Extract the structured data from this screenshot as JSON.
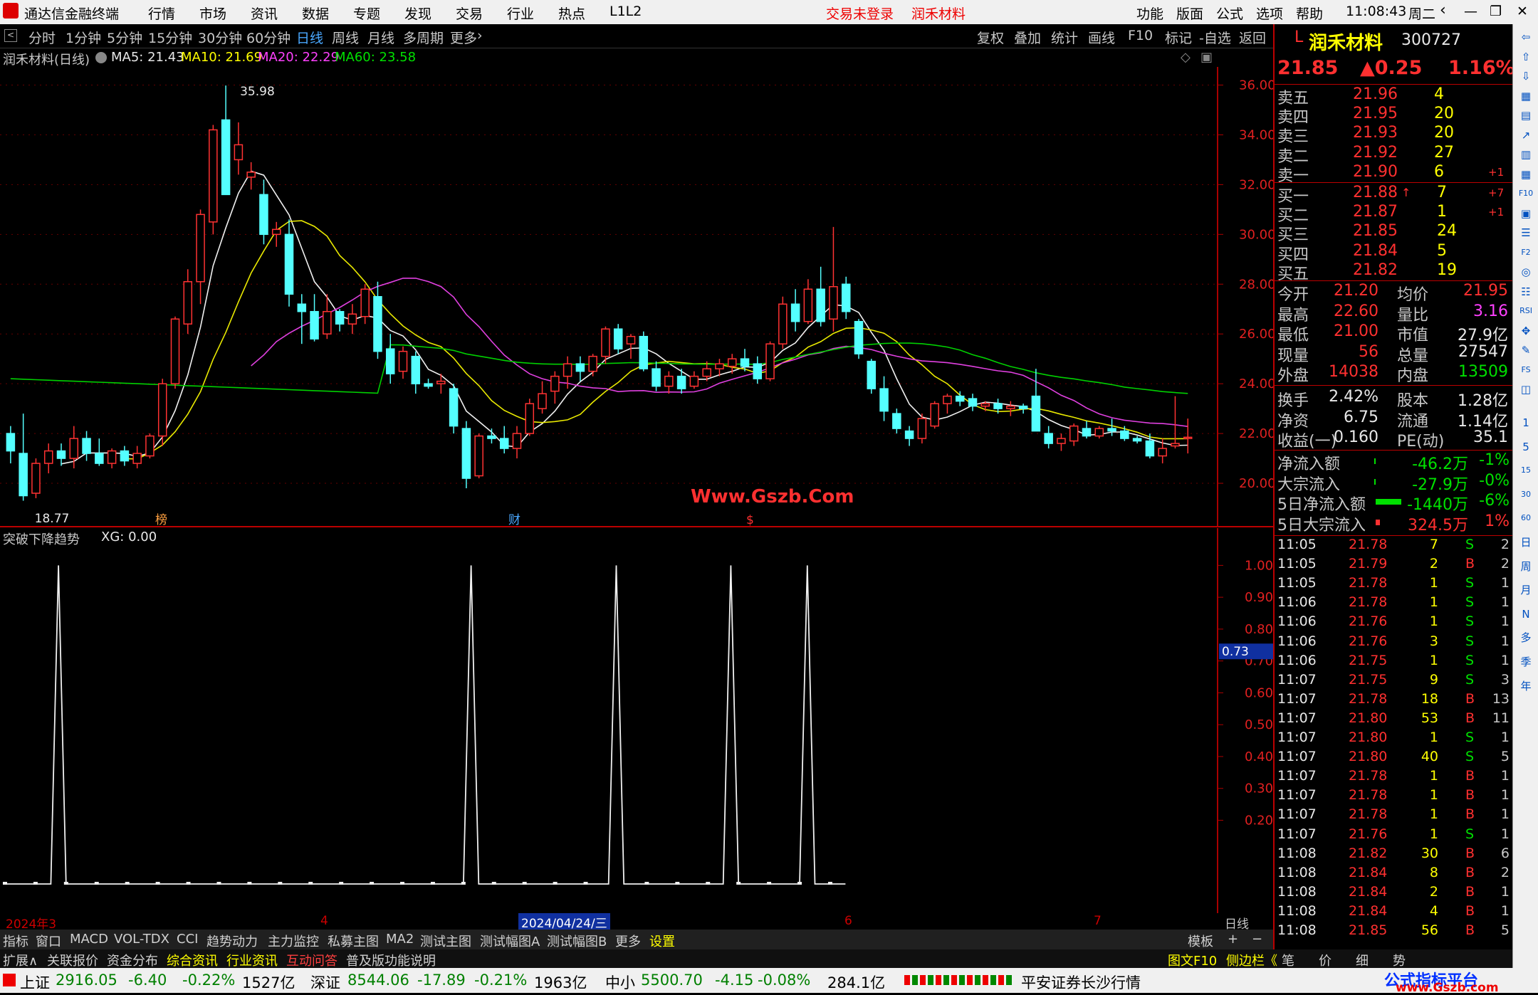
{
  "app": {
    "title": "通达信金融终端",
    "menu": [
      "行情",
      "市场",
      "资讯",
      "数据",
      "专题",
      "发现",
      "交易",
      "行业",
      "热点",
      "L1L2"
    ],
    "notice": "交易未登录",
    "stock_link": "润禾材料",
    "right_menu": [
      "功能",
      "版面",
      "公式",
      "选项",
      "帮助"
    ],
    "time": "11:08:43",
    "weekday": "周二"
  },
  "periods": [
    "分时",
    "1分钟",
    "5分钟",
    "15分钟",
    "30分钟",
    "60分钟",
    "日线",
    "周线",
    "月线",
    "多周期",
    "更多"
  ],
  "active_period": "日线",
  "tools": [
    "复权",
    "叠加",
    "统计",
    "画线",
    "F10",
    "标记",
    "-自选",
    "返回"
  ],
  "info": {
    "name": "润禾材料(日线)",
    "ma5": "MA5: 21.43",
    "ma10": "MA10: 21.69",
    "ma20": "MA20: 22.29",
    "ma60": "MA60: 23.58"
  },
  "chart_data": {
    "type": "candlestick",
    "series_name": "润禾材料(日线)",
    "ohlc": [
      [
        22.0,
        22.3,
        20.8,
        21.3
      ],
      [
        21.2,
        22.8,
        19.3,
        19.5
      ],
      [
        19.6,
        21.0,
        19.4,
        20.8
      ],
      [
        20.8,
        21.6,
        20.4,
        21.3
      ],
      [
        21.3,
        21.6,
        20.7,
        21.0
      ],
      [
        21.0,
        22.3,
        20.6,
        21.8
      ],
      [
        21.8,
        22.1,
        20.9,
        21.2
      ],
      [
        21.2,
        21.8,
        20.7,
        20.8
      ],
      [
        20.8,
        21.4,
        20.6,
        21.3
      ],
      [
        21.3,
        21.5,
        20.7,
        20.9
      ],
      [
        20.8,
        21.5,
        20.6,
        21.2
      ],
      [
        21.1,
        22.0,
        21.0,
        21.9
      ],
      [
        21.9,
        24.2,
        21.5,
        24.0
      ],
      [
        24.0,
        26.7,
        23.8,
        26.6
      ],
      [
        26.4,
        28.6,
        26.0,
        28.1
      ],
      [
        28.1,
        31.0,
        27.2,
        30.8
      ],
      [
        30.5,
        34.4,
        30.0,
        34.2
      ],
      [
        34.6,
        35.98,
        31.6,
        31.6
      ],
      [
        33.0,
        34.5,
        32.4,
        33.6
      ],
      [
        32.3,
        32.9,
        31.8,
        32.5
      ],
      [
        31.6,
        32.2,
        29.6,
        30.0
      ],
      [
        30.0,
        30.5,
        29.5,
        30.2
      ],
      [
        30.0,
        30.6,
        27.1,
        27.6
      ],
      [
        27.2,
        27.6,
        25.6,
        26.9
      ],
      [
        26.9,
        27.6,
        25.7,
        25.8
      ],
      [
        26.0,
        27.6,
        25.8,
        26.9
      ],
      [
        26.9,
        27.0,
        26.1,
        26.4
      ],
      [
        26.4,
        27.2,
        26.0,
        26.8
      ],
      [
        26.7,
        28.0,
        26.4,
        27.8
      ],
      [
        27.5,
        28.1,
        25.0,
        25.3
      ],
      [
        25.4,
        26.0,
        24.0,
        24.4
      ],
      [
        24.5,
        25.5,
        24.2,
        25.3
      ],
      [
        25.1,
        25.3,
        23.6,
        24.0
      ],
      [
        24.0,
        24.2,
        23.8,
        23.9
      ],
      [
        24.0,
        24.4,
        23.6,
        24.1
      ],
      [
        23.8,
        24.0,
        22.0,
        22.3
      ],
      [
        22.2,
        22.5,
        19.8,
        20.2
      ],
      [
        20.3,
        22.0,
        20.2,
        21.9
      ],
      [
        21.9,
        22.2,
        21.6,
        21.8
      ],
      [
        21.8,
        22.3,
        21.2,
        21.4
      ],
      [
        21.4,
        22.3,
        21.0,
        22.0
      ],
      [
        22.0,
        23.4,
        21.9,
        23.2
      ],
      [
        23.0,
        24.1,
        22.8,
        23.6
      ],
      [
        23.7,
        24.5,
        23.2,
        24.3
      ],
      [
        24.3,
        25.1,
        23.8,
        24.8
      ],
      [
        24.8,
        25.1,
        24.1,
        24.5
      ],
      [
        24.5,
        25.2,
        24.3,
        25.1
      ],
      [
        25.1,
        26.3,
        24.8,
        26.2
      ],
      [
        26.2,
        26.4,
        25.2,
        25.4
      ],
      [
        25.6,
        26.0,
        25.0,
        25.9
      ],
      [
        25.9,
        26.1,
        24.5,
        24.6
      ],
      [
        24.6,
        24.9,
        23.7,
        23.9
      ],
      [
        23.9,
        24.5,
        23.6,
        24.3
      ],
      [
        24.3,
        24.6,
        23.6,
        23.8
      ],
      [
        23.9,
        24.5,
        23.8,
        24.3
      ],
      [
        24.3,
        24.9,
        24.1,
        24.6
      ],
      [
        24.6,
        25.0,
        24.3,
        24.8
      ],
      [
        24.7,
        25.2,
        24.4,
        25.0
      ],
      [
        25.0,
        25.4,
        24.5,
        24.7
      ],
      [
        24.8,
        25.1,
        24.0,
        24.2
      ],
      [
        24.2,
        25.7,
        24.1,
        25.6
      ],
      [
        25.6,
        27.5,
        25.4,
        27.2
      ],
      [
        27.2,
        27.8,
        26.1,
        26.5
      ],
      [
        26.5,
        28.2,
        26.4,
        27.8
      ],
      [
        27.8,
        28.7,
        26.3,
        26.5
      ],
      [
        26.6,
        30.3,
        26.1,
        27.9
      ],
      [
        28.0,
        28.3,
        26.6,
        26.9
      ],
      [
        26.5,
        26.6,
        25.0,
        25.2
      ],
      [
        24.9,
        25.0,
        23.6,
        23.8
      ],
      [
        23.8,
        24.3,
        22.5,
        22.9
      ],
      [
        22.8,
        23.0,
        22.0,
        22.2
      ],
      [
        22.1,
        22.3,
        21.5,
        21.8
      ],
      [
        21.8,
        22.8,
        21.6,
        22.6
      ],
      [
        22.3,
        23.3,
        22.2,
        23.2
      ],
      [
        23.2,
        23.6,
        22.8,
        23.5
      ],
      [
        23.5,
        23.7,
        23.1,
        23.3
      ],
      [
        23.4,
        23.6,
        22.9,
        23.1
      ],
      [
        23.1,
        23.3,
        22.9,
        23.2
      ],
      [
        23.2,
        23.4,
        22.8,
        23.0
      ],
      [
        23.0,
        23.3,
        22.7,
        23.1
      ],
      [
        23.1,
        23.2,
        22.8,
        23.0
      ],
      [
        23.5,
        24.6,
        23.4,
        22.1
      ],
      [
        22.0,
        22.3,
        21.4,
        21.6
      ],
      [
        21.6,
        22.0,
        21.3,
        21.8
      ],
      [
        21.7,
        22.4,
        21.5,
        22.3
      ],
      [
        22.2,
        22.5,
        21.8,
        21.9
      ],
      [
        21.9,
        22.3,
        21.8,
        22.2
      ],
      [
        22.2,
        22.6,
        21.9,
        22.1
      ],
      [
        22.1,
        22.3,
        21.7,
        21.8
      ],
      [
        21.8,
        21.9,
        21.6,
        21.7
      ],
      [
        21.7,
        22.0,
        21.0,
        21.1
      ],
      [
        21.1,
        21.8,
        20.8,
        21.4
      ],
      [
        21.5,
        23.5,
        21.4,
        21.6
      ],
      [
        21.8,
        22.6,
        21.2,
        21.85
      ]
    ],
    "ma_lines": [
      "MA5",
      "MA10",
      "MA20",
      "MA60"
    ],
    "ma_values": {
      "MA5": 21.43,
      "MA10": 21.69,
      "MA20": 22.29,
      "MA60": 23.58
    },
    "ylim": [
      19.0,
      36.5
    ],
    "yticks": [
      "36.00",
      "34.00",
      "32.00",
      "30.00",
      "28.00",
      "26.00",
      "24.00",
      "22.00",
      "20.00"
    ],
    "annotations": {
      "high": "35.98",
      "low": "18.77",
      "watermark": "Www.Gszb.Com",
      "marks": [
        "榜",
        "财",
        "$"
      ]
    },
    "indicator": {
      "name": "突破下降趋势",
      "label": "XG: 0.00",
      "ylim": [
        0,
        1.05
      ],
      "yticks": [
        "1.00",
        "0.90",
        "0.80",
        "0.70",
        "0.60",
        "0.50",
        "0.40",
        "0.30",
        "0.20"
      ],
      "cursor_value": "0.73",
      "spikes_at_bar": [
        7,
        61,
        80,
        95,
        105
      ]
    },
    "time_labels": [
      "2024年3",
      "4",
      "2024/04/24/三",
      "6",
      "7"
    ],
    "period_label": "日线"
  },
  "quote": {
    "market_tag": "L",
    "name": "润禾材料",
    "code": "300727",
    "price": "21.85",
    "change": "▲0.25",
    "pct": "1.16%",
    "asks": [
      {
        "l": "卖五",
        "p": "21.96",
        "v": "4",
        "d": ""
      },
      {
        "l": "卖四",
        "p": "21.95",
        "v": "20",
        "d": ""
      },
      {
        "l": "卖三",
        "p": "21.93",
        "v": "20",
        "d": ""
      },
      {
        "l": "卖二",
        "p": "21.92",
        "v": "27",
        "d": ""
      },
      {
        "l": "卖一",
        "p": "21.90",
        "v": "6",
        "d": "+1"
      }
    ],
    "bids": [
      {
        "l": "买一",
        "p": "21.88",
        "a": "↑",
        "v": "7",
        "d": "+7"
      },
      {
        "l": "买二",
        "p": "21.87",
        "a": "",
        "v": "1",
        "d": "+1"
      },
      {
        "l": "买三",
        "p": "21.85",
        "a": "",
        "v": "24",
        "d": ""
      },
      {
        "l": "买四",
        "p": "21.84",
        "a": "",
        "v": "5",
        "d": ""
      },
      {
        "l": "买五",
        "p": "21.82",
        "a": "",
        "v": "19",
        "d": ""
      }
    ],
    "stats": [
      {
        "l1": "今开",
        "v1": "21.20",
        "c1": "red",
        "l2": "均价",
        "v2": "21.95",
        "c2": "red"
      },
      {
        "l1": "最高",
        "v1": "22.60",
        "c1": "red",
        "l2": "量比",
        "v2": "3.16",
        "c2": "mag"
      },
      {
        "l1": "最低",
        "v1": "21.00",
        "c1": "red",
        "l2": "市值",
        "v2": "27.9亿",
        "c2": "white"
      },
      {
        "l1": "现量",
        "v1": "56",
        "c1": "red",
        "l2": "总量",
        "v2": "27547",
        "c2": "white"
      },
      {
        "l1": "外盘",
        "v1": "14038",
        "c1": "red",
        "l2": "内盘",
        "v2": "13509",
        "c2": "green"
      },
      {
        "l1": "换手",
        "v1": "2.42%",
        "c1": "white",
        "l2": "股本",
        "v2": "1.28亿",
        "c2": "white"
      },
      {
        "l1": "净资",
        "v1": "6.75",
        "c1": "white",
        "l2": "流通",
        "v2": "1.14亿",
        "c2": "white"
      },
      {
        "l1": "收益(一)",
        "v1": "0.160",
        "c1": "white",
        "l2": "PE(动)",
        "v2": "35.1",
        "c2": "white"
      }
    ],
    "flows": [
      {
        "l": "净流入额",
        "v": "-46.2万",
        "p": "-1%",
        "c": "green"
      },
      {
        "l": "大宗流入",
        "v": "-27.9万",
        "p": "-0%",
        "c": "green"
      },
      {
        "l": "5日净流入额",
        "v": "-1440万",
        "p": "-6%",
        "c": "green"
      },
      {
        "l": "5日大宗流入",
        "v": "324.5万",
        "p": "1%",
        "c": "red"
      }
    ],
    "ticks": [
      [
        "11:05",
        "21.78",
        "7",
        "S",
        "2"
      ],
      [
        "11:05",
        "21.79",
        "2",
        "B",
        "2"
      ],
      [
        "11:05",
        "21.78",
        "1",
        "S",
        "1"
      ],
      [
        "11:06",
        "21.78",
        "1",
        "S",
        "1"
      ],
      [
        "11:06",
        "21.76",
        "1",
        "S",
        "1"
      ],
      [
        "11:06",
        "21.76",
        "3",
        "S",
        "1"
      ],
      [
        "11:06",
        "21.75",
        "1",
        "S",
        "1"
      ],
      [
        "11:07",
        "21.75",
        "9",
        "S",
        "3"
      ],
      [
        "11:07",
        "21.78",
        "18",
        "B",
        "13"
      ],
      [
        "11:07",
        "21.80",
        "53",
        "B",
        "11"
      ],
      [
        "11:07",
        "21.80",
        "1",
        "S",
        "1"
      ],
      [
        "11:07",
        "21.80",
        "40",
        "S",
        "5"
      ],
      [
        "11:07",
        "21.78",
        "1",
        "B",
        "1"
      ],
      [
        "11:07",
        "21.78",
        "1",
        "B",
        "1"
      ],
      [
        "11:07",
        "21.78",
        "1",
        "B",
        "1"
      ],
      [
        "11:07",
        "21.76",
        "1",
        "S",
        "1"
      ],
      [
        "11:08",
        "21.82",
        "30",
        "B",
        "6"
      ],
      [
        "11:08",
        "21.84",
        "8",
        "B",
        "2"
      ],
      [
        "11:08",
        "21.84",
        "2",
        "B",
        "1"
      ],
      [
        "11:08",
        "21.84",
        "4",
        "B",
        "1"
      ],
      [
        "11:08",
        "21.85",
        "56",
        "B",
        "5"
      ]
    ]
  },
  "bottom_tabs": [
    "指标",
    "窗口",
    "MACD",
    "VOL-TDX",
    "CCI",
    "趋势动力",
    "主力监控",
    "私募主图",
    "MA2",
    "测试主图",
    "测试幅图A",
    "测试幅图B",
    "更多",
    "设置"
  ],
  "bottom_right": [
    "模板",
    "+",
    "−"
  ],
  "bottom_tabs2": [
    "扩展∧",
    "关联报价",
    "资金分布",
    "综合资讯",
    "行业资讯",
    "互动问答",
    "普及版功能说明"
  ],
  "bottom_right2": [
    "图文F10",
    "侧边栏《",
    "笔",
    "价",
    "细",
    "势"
  ],
  "side_icons": [
    "⇦",
    "⇧",
    "⇩",
    "▦",
    "▤",
    "↗",
    "▥",
    "▦",
    "F10",
    "▣",
    "☰",
    "F2",
    "◎",
    "☷",
    "RSI",
    "✥",
    "✎",
    "FS",
    "◫",
    "1",
    "5",
    "15",
    "30",
    "60",
    "日",
    "周",
    "月",
    "N",
    "多",
    "季",
    "年"
  ],
  "status": {
    "sh_label": "上证",
    "sh": "2916.05",
    "sh_chg": "-6.40",
    "sh_pct": "-0.22%",
    "sh_amt": "1527亿",
    "sz_label": "深证",
    "sz": "8544.06",
    "sz_chg": "-17.89",
    "sz_pct": "-0.21%",
    "sz_amt": "1963亿",
    "zx_label": "中小",
    "zx": "5500.70",
    "zx_chg": "-4.15",
    "zx_pct": "-0.08%",
    "zx_amt": "284.1亿",
    "broker": "平安证券长沙行情",
    "brand": "公式指标平台",
    "brand_url": "www.Gszb.com"
  }
}
